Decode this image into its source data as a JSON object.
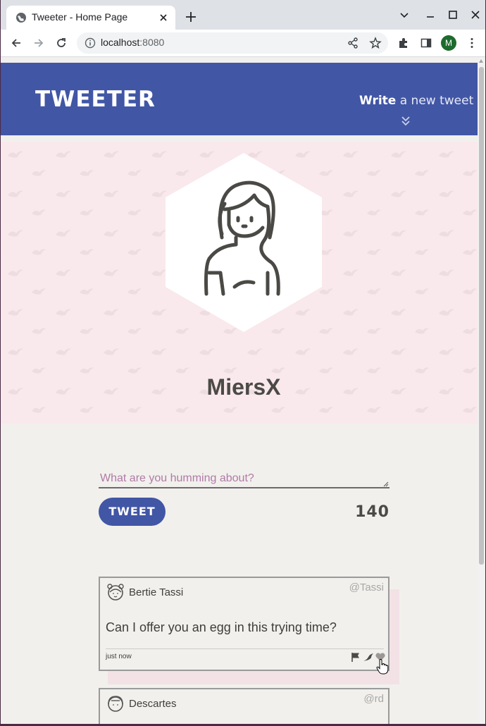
{
  "browser": {
    "tab_title": "Tweeter - Home Page",
    "url_host": "localhost",
    "url_port": ":8080",
    "profile_initial": "M"
  },
  "navbar": {
    "brand": "Tweeter",
    "write_bold": "Write",
    "write_rest": "a new tweet"
  },
  "profile": {
    "username": "MiersX"
  },
  "compose": {
    "placeholder": "What are you humming about?",
    "button_label": "Tweet",
    "counter": "140"
  },
  "tweets": [
    {
      "name": "Bertie Tassi",
      "handle": "@Tassi",
      "content": "Can I offer you an egg in this trying time?",
      "time": "just now"
    },
    {
      "name": "Descartes",
      "handle": "@rd",
      "content": "",
      "time": ""
    }
  ],
  "colors": {
    "accent": "#4156a5",
    "header_bg": "#f9e9ec",
    "page_bg": "#f2f0ec"
  }
}
